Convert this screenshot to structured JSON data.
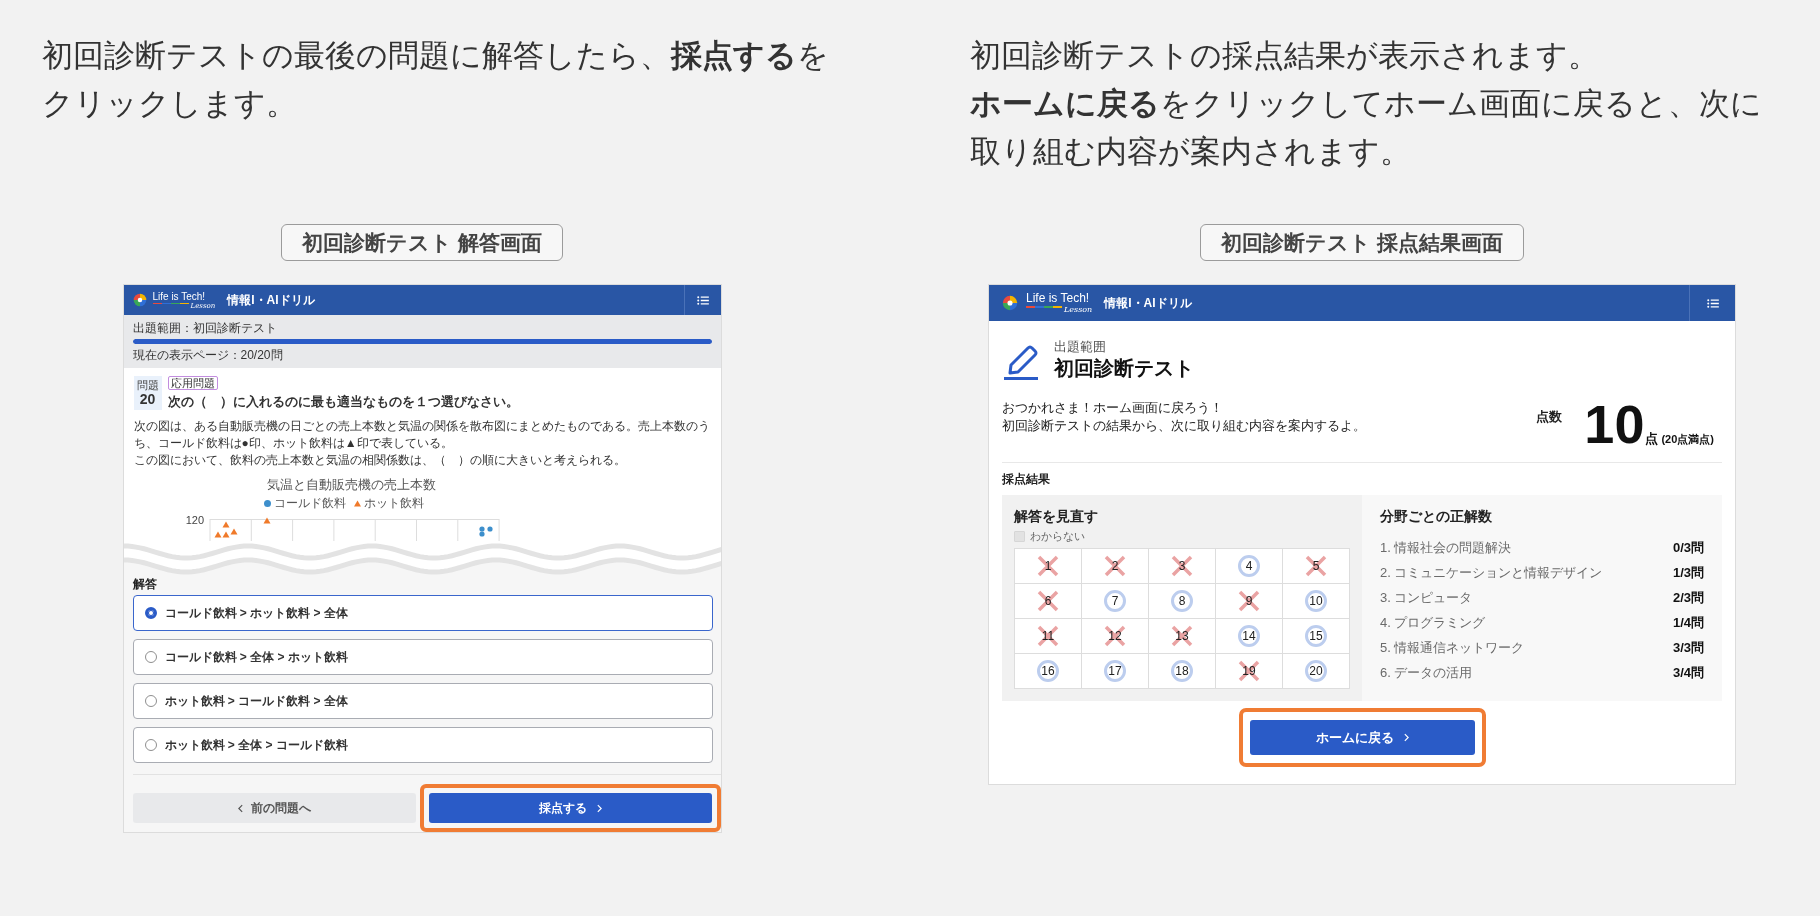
{
  "answer_step": {
    "instruction": [
      "初回診断テストの最後の問題に解答したら、**採点する**をクリックします。"
    ],
    "caption": "初回診断テスト 解答画面",
    "screen": {
      "header": {
        "logo": "Life is Tech!",
        "logo_sub": "Lesson",
        "title": "情報I・AIドリル"
      },
      "progress": {
        "scope": "出題範囲：初回診断テスト",
        "level": 1,
        "page": "現在の表示ページ：20/20問"
      },
      "question": {
        "label": "問題",
        "number": "20",
        "tag": "応用問題",
        "title": "次の（　）に入れるのに最も適当なものを１つ選びなさい。",
        "body": [
          "次の図は、ある自動販売機の日ごとの売上本数と気温の関係を散布図にまとめたものである。売上本数のうち、コールド飲料は●印、ホット飲料は▲印で表している。",
          "この図において、飲料の売上本数と気温の相関係数は、（　）の順に大きいと考えられる。"
        ]
      },
      "chart": {
        "title": "気温と自動販売機の売上本数",
        "legend": [
          {
            "label": "コールド飲料",
            "color": "#3d8fcc",
            "kind": "dot"
          },
          {
            "label": "ホット飲料",
            "color": "#f07a2a",
            "kind": "triangle"
          }
        ],
        "y_tick": "120"
      },
      "answer": {
        "heading": "解答",
        "options": [
          {
            "text": "コールド飲料 > ホット飲料 > 全体",
            "selected": true
          },
          {
            "text": "コールド飲料 > 全体 > ホット飲料",
            "selected": false
          },
          {
            "text": "ホット飲料 > コールド飲料 > 全体",
            "selected": false
          },
          {
            "text": "ホット飲料 > 全体 > コールド飲料",
            "selected": false
          }
        ]
      },
      "buttons": {
        "previous": "前の問題へ",
        "submit": {
          "label": "採点する",
          "highlighted": true
        }
      }
    }
  },
  "result_step": {
    "instruction": [
      "初回診断テストの採点結果が表示されます。",
      "**ホームに戻る**をクリックしてホーム画面に戻ると、次に取り組む内容が案内されます。"
    ],
    "caption": "初回診断テスト 採点結果画面",
    "screen": {
      "header": {
        "logo": "Life is Tech!",
        "logo_sub": "Lesson",
        "title": "情報I・AIドリル"
      },
      "test": {
        "scope_label": "出題範囲",
        "name": "初回診断テスト"
      },
      "message": [
        "おつかれさま！ホーム画面に戻ろう！",
        "初回診断テストの結果から、次に取り組む内容を案内するよ。"
      ],
      "score": {
        "label": "点数",
        "value": "10",
        "unit": "点",
        "max": "(20点満点)"
      },
      "results": {
        "title": "採点結果",
        "review": {
          "title": "解答を見直す",
          "filter": {
            "label": "わからない",
            "checked": false
          },
          "answers": [
            {
              "number": "1",
              "correct": false
            },
            {
              "number": "2",
              "correct": false
            },
            {
              "number": "3",
              "correct": false
            },
            {
              "number": "4",
              "correct": true
            },
            {
              "number": "5",
              "correct": false
            },
            {
              "number": "6",
              "correct": false
            },
            {
              "number": "7",
              "correct": true
            },
            {
              "number": "8",
              "correct": true
            },
            {
              "number": "9",
              "correct": false
            },
            {
              "number": "10",
              "correct": true
            },
            {
              "number": "11",
              "correct": false
            },
            {
              "number": "12",
              "correct": false
            },
            {
              "number": "13",
              "correct": false
            },
            {
              "number": "14",
              "correct": true
            },
            {
              "number": "15",
              "correct": true
            },
            {
              "number": "16",
              "correct": true
            },
            {
              "number": "17",
              "correct": true
            },
            {
              "number": "18",
              "correct": true
            },
            {
              "number": "19",
              "correct": false
            },
            {
              "number": "20",
              "correct": true
            }
          ]
        },
        "by_field": {
          "title": "分野ごとの正解数",
          "rows": [
            {
              "label": "1. 情報社会の問題解決",
              "score": "0/3問"
            },
            {
              "label": "2. コミュニケーションと情報デザイン",
              "score": "1/3問"
            },
            {
              "label": "3. コンピュータ",
              "score": "2/3問"
            },
            {
              "label": "4. プログラミング",
              "score": "1/4問"
            },
            {
              "label": "5. 情報通信ネットワーク",
              "score": "3/3問"
            },
            {
              "label": "6. データの活用",
              "score": "3/4問"
            }
          ]
        }
      },
      "home_button": {
        "label": "ホームに戻る",
        "highlighted": true
      }
    }
  }
}
